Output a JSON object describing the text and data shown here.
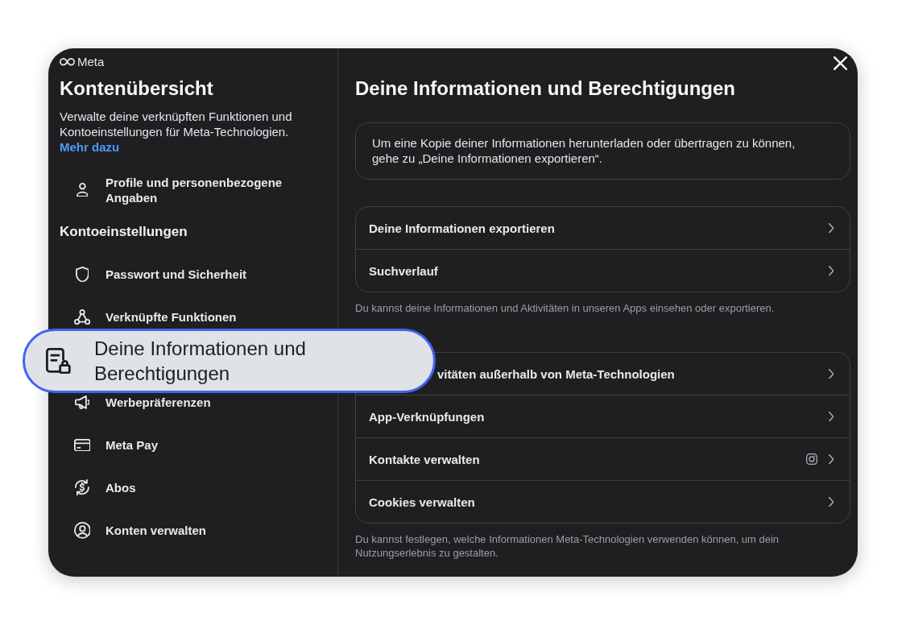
{
  "dialog": {
    "brand": "Meta",
    "sidebar": {
      "title": "Kontenübersicht",
      "description": "Verwalte deine verknüpften Funktionen und Kontoeinstellungen für Meta-Technologien.",
      "link": "Mehr dazu",
      "items": [
        {
          "label": "Profile und personenbezogene Angaben",
          "selected": false
        }
      ],
      "section": {
        "title": "Kontoeinstellungen",
        "items": [
          {
            "label": "Passwort und Sicherheit",
            "selected": false
          },
          {
            "label": "Verknüpfte Funktionen",
            "selected": false
          },
          {
            "label": "Deine Informationen und Berechtigungen",
            "selected": true
          },
          {
            "label": "Werbepräferenzen",
            "selected": false
          },
          {
            "label": "Meta Pay",
            "selected": false
          },
          {
            "label": "Abos",
            "selected": false
          },
          {
            "label": "Konten verwalten",
            "selected": false
          }
        ]
      }
    },
    "content": {
      "title": "Deine Informationen und Berechtigungen",
      "notice": "Um eine Kopie deiner Informationen herunterladen oder übertragen zu können, gehe zu „Deine Informationen exportieren“.",
      "groups": [
        {
          "rows": [
            {
              "label": "Deine Informationen exportieren"
            },
            {
              "label": "Suchverlauf"
            }
          ],
          "footnote": "Du kannst deine Informationen und Aktivitäten in unseren Apps einsehen oder exportieren."
        },
        {
          "rows": [
            {
              "label": "vitäten außerhalb von Meta-Technologien"
            },
            {
              "label": "App-Verknüpfungen"
            },
            {
              "label": "Kontakte verwalten"
            },
            {
              "label": "Cookies verwalten"
            }
          ],
          "footnote": "Du kannst festlegen, welche Informationen Meta-Technologien verwenden können, um dein Nutzungserlebnis zu gestalten."
        }
      ]
    }
  }
}
